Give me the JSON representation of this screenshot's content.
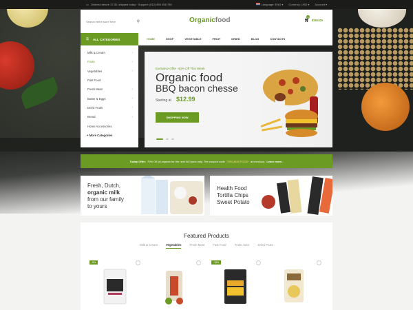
{
  "topbar": {
    "left_text": "Ordered before 17:30, shipped today · Support: (012) 800 456 789",
    "language": "Language: ENG",
    "currency": "Currency: USD",
    "account": "Account"
  },
  "header": {
    "search_placeholder": "Search entire store here",
    "logo_part1": "Organic",
    "logo_part2": "food",
    "cart_count": "0",
    "cart_total": "$204.00"
  },
  "categories": {
    "header": "ALL CATEGORIES",
    "items": [
      {
        "label": "Milk & Cream",
        "arrow": true
      },
      {
        "label": "Fruits",
        "arrow": true
      },
      {
        "label": "Vegetables",
        "arrow": true
      },
      {
        "label": "Fast Food",
        "arrow": false
      },
      {
        "label": "Fresh Meat",
        "arrow": true
      },
      {
        "label": "Butter & Eggs",
        "arrow": true
      },
      {
        "label": "Dried Fruits",
        "arrow": true
      },
      {
        "label": "Bread",
        "arrow": true
      },
      {
        "label": "Home Accessories",
        "arrow": false
      }
    ],
    "more": "+ More Categories"
  },
  "nav": [
    "HOME",
    "SHOP",
    "VEGETABLE",
    "FRUIT",
    "DRIED",
    "BLOG",
    "CONTACTS"
  ],
  "hero": {
    "offer": "Exclusive Offer -40% Off This Week",
    "title1": "Organic food",
    "title2": "BBQ bacon chesse",
    "price_label": "Starting at",
    "price": "$12.99",
    "button": "SHOPPING NOW"
  },
  "promo": {
    "lead": "Today Offer:",
    "text": "70% Off all organic for the next 08 hours only. The coupon code",
    "code": "\"ORGANICFOOD\"",
    "tail": "at checkout.",
    "link": "Learn more.."
  },
  "banner_left": {
    "line1": "Fresh, Dutch,",
    "line2": "organic milk",
    "line3": "from our family",
    "line4": "to yours"
  },
  "banner_right": {
    "line1": "Health Food",
    "line2": "Tortilla Chips",
    "line3": "Sweet Potato"
  },
  "featured": {
    "title": "Featured Products",
    "tabs": [
      "Milk & Cream",
      "Vegetables",
      "Fresh Meat",
      "Fast Food",
      "Fruits Juice",
      "Dried Fruits"
    ],
    "active_tab": 1,
    "badges": [
      "-8%",
      "-15%"
    ]
  },
  "colors": {
    "accent": "#6b9b23",
    "dark_bg": "#1f211e"
  }
}
